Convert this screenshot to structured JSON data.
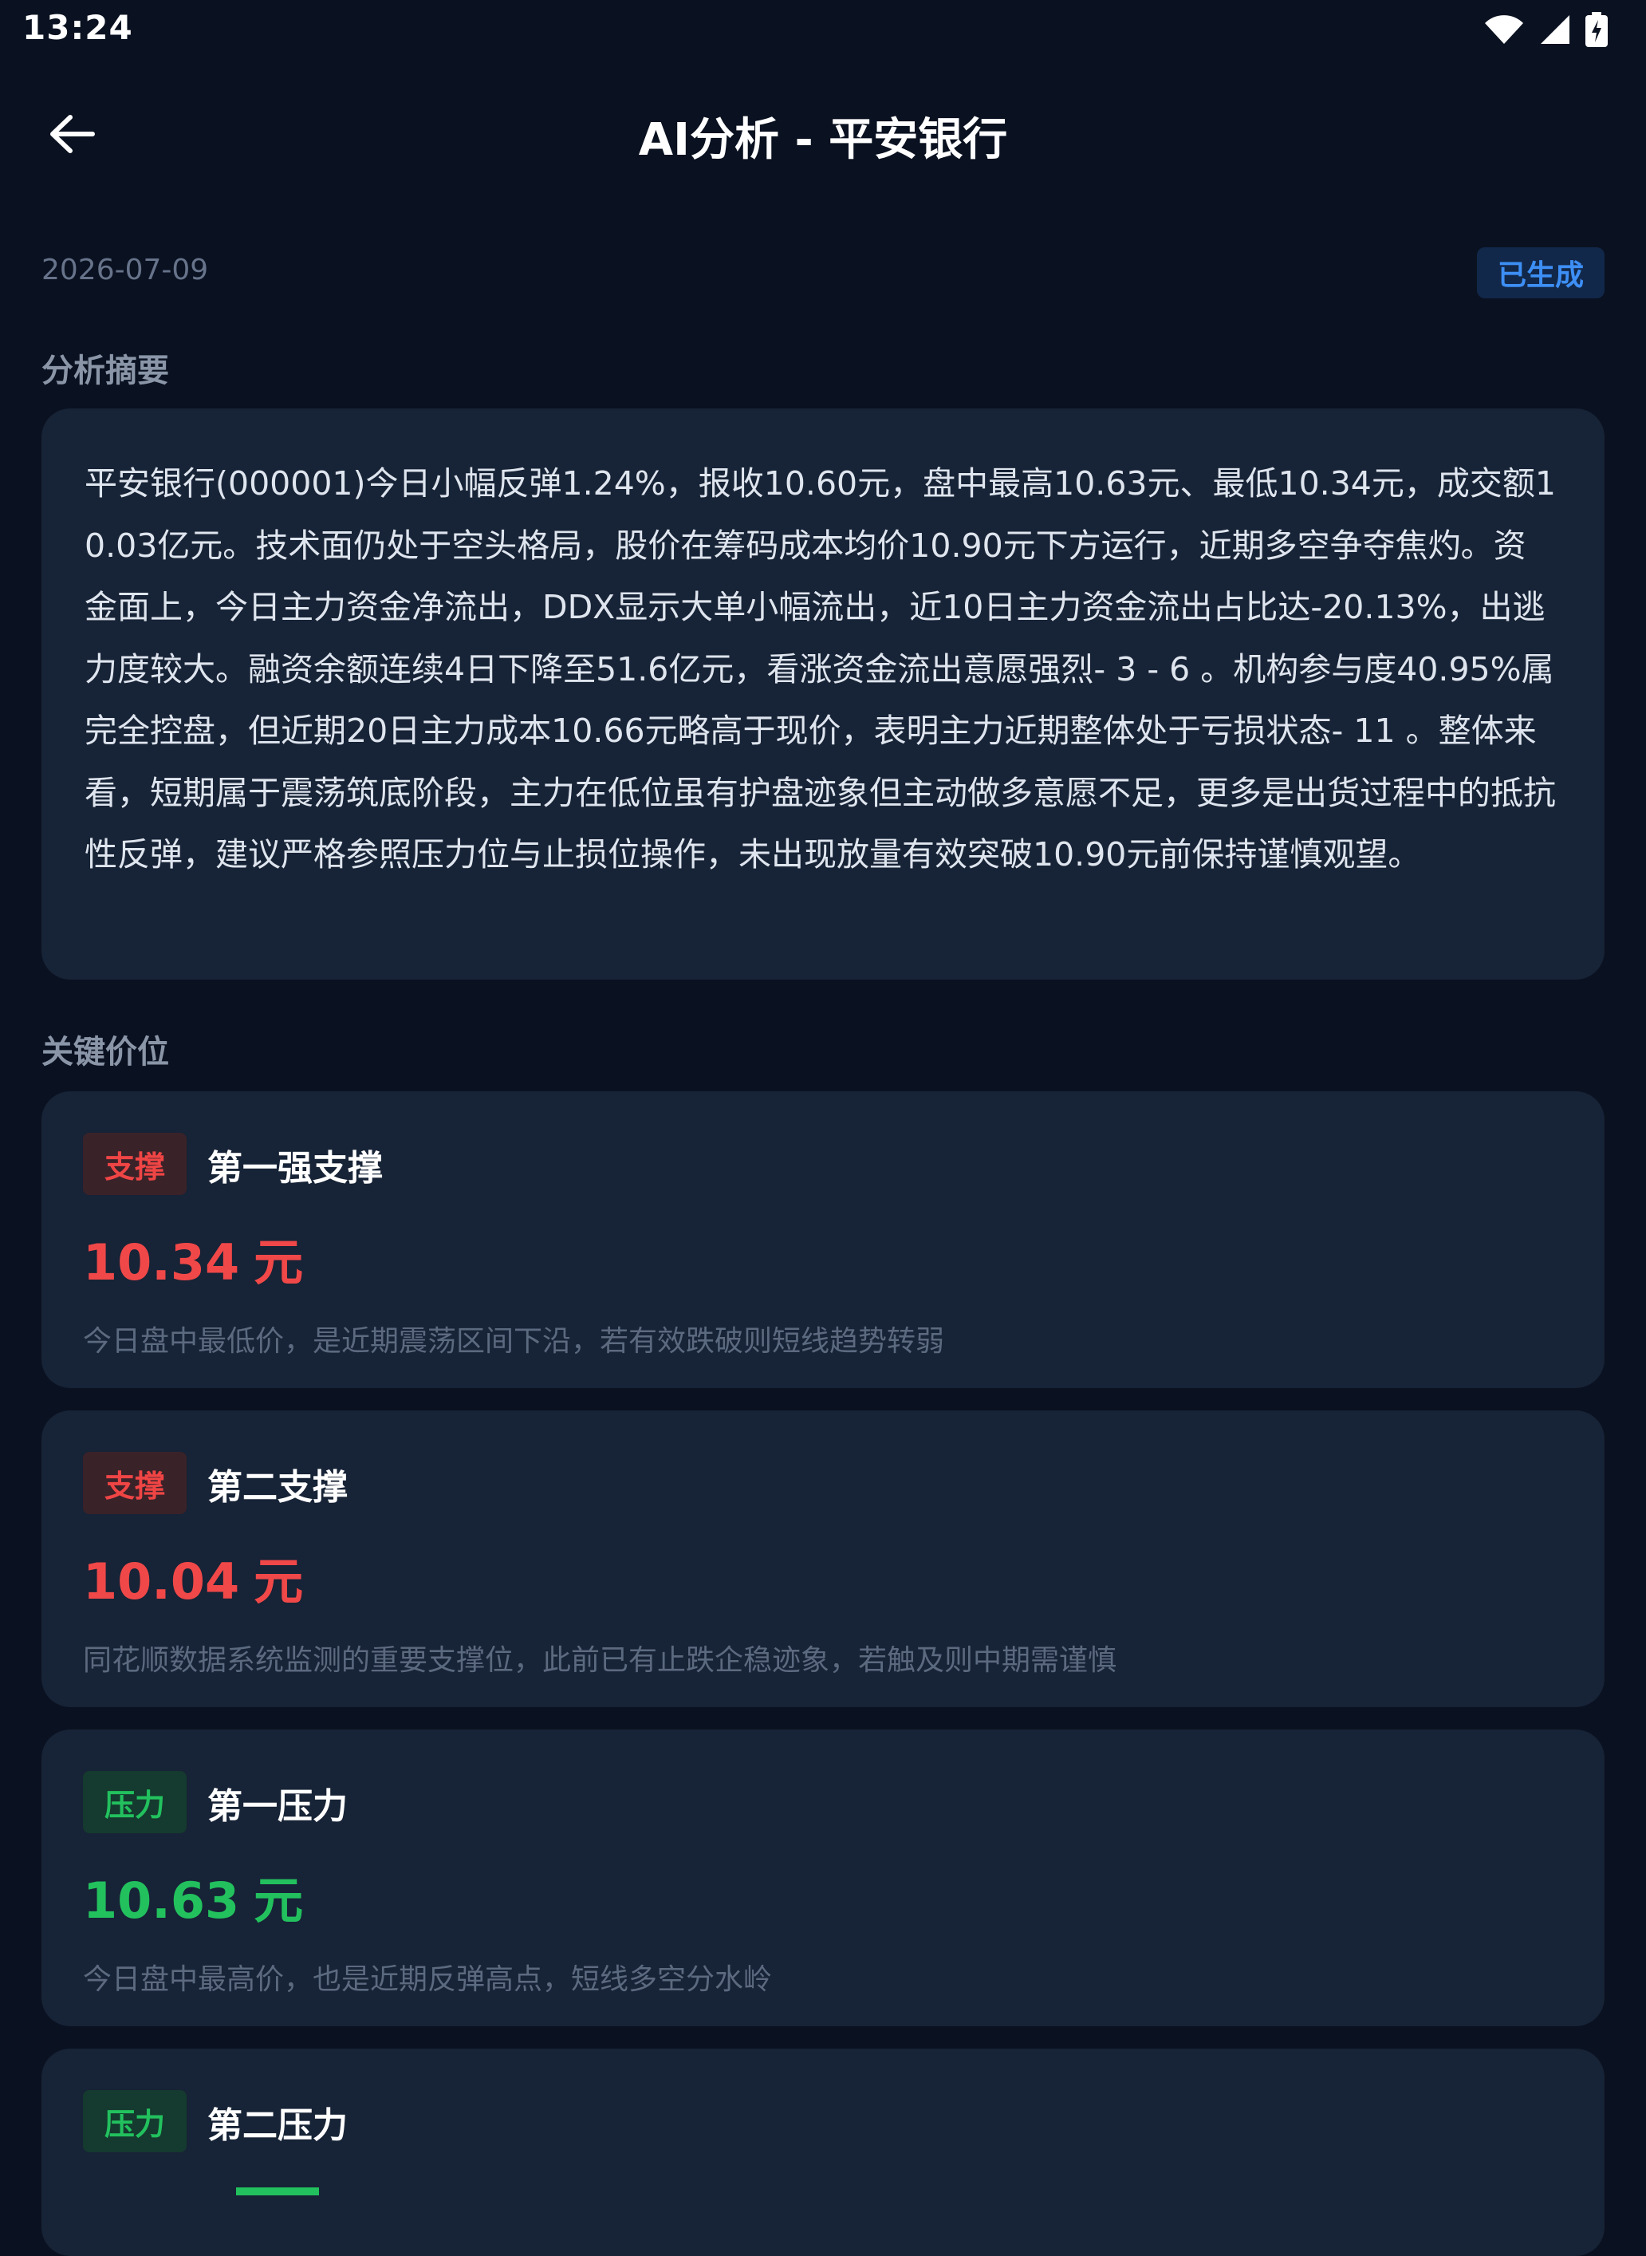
{
  "status_bar": {
    "time": "13:24"
  },
  "header": {
    "title": "AI分析 - 平安银行"
  },
  "meta": {
    "date": "2026-07-09",
    "status": "已生成"
  },
  "summary": {
    "heading": "分析摘要",
    "text": "平安银行(000001)今日小幅反弹1.24%，报收10.60元，盘中最高10.63元、最低10.34元，成交额10.03亿元。技术面仍处于空头格局，股价在筹码成本均价10.90元下方运行，近期多空争夺焦灼。资金面上，今日主力资金净流出，DDX显示大单小幅流出，近10日主力资金流出占比达-20.13%，出逃力度较大。融资余额连续4日下降至51.6亿元，看涨资金流出意愿强烈- 3 - 6 。机构参与度40.95%属完全控盘，但近期20日主力成本10.66元略高于现价，表明主力近期整体处于亏损状态- 11 。整体来看，短期属于震荡筑底阶段，主力在低位虽有护盘迹象但主动做多意愿不足，更多是出货过程中的抵抗性反弹，建议严格参照压力位与止损位操作，未出现放量有效突破10.90元前保持谨慎观望。"
  },
  "key_levels": {
    "heading": "关键价位",
    "unit": "元",
    "items": [
      {
        "tag": "支撑",
        "name": "第一强支撑",
        "price": "10.34",
        "desc": "今日盘中最低价，是近期震荡区间下沿，若有效跌破则短线趋势转弱"
      },
      {
        "tag": "支撑",
        "name": "第二支撑",
        "price": "10.04",
        "desc": "同花顺数据系统监测的重要支撑位，此前已有止跌企稳迹象，若触及则中期需谨慎"
      },
      {
        "tag": "压力",
        "name": "第一压力",
        "price": "10.63",
        "desc": "今日盘中最高价，也是近期反弹高点，短线多空分水岭"
      },
      {
        "tag": "压力",
        "name": "第二压力"
      }
    ]
  },
  "colors": {
    "background": "#0a1120",
    "card": "#172336",
    "support": "#f04848",
    "resistance": "#22c15e",
    "accent": "#3d8ff5"
  }
}
